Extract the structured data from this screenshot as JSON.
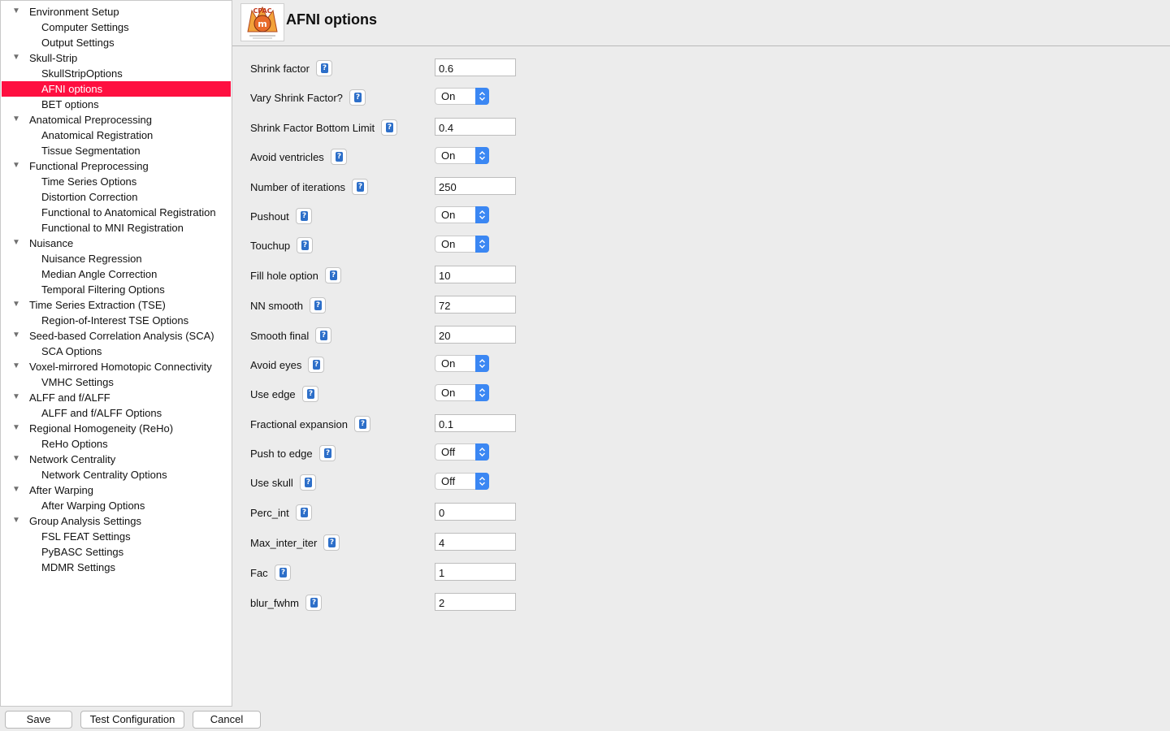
{
  "sidebar": {
    "items": [
      {
        "label": "Environment Setup",
        "level": 0
      },
      {
        "label": "Computer Settings",
        "level": 1
      },
      {
        "label": "Output Settings",
        "level": 1
      },
      {
        "label": "Skull-Strip",
        "level": 0
      },
      {
        "label": "SkullStripOptions",
        "level": 1
      },
      {
        "label": "AFNI options",
        "level": 1,
        "selected": true
      },
      {
        "label": "BET options",
        "level": 1
      },
      {
        "label": "Anatomical Preprocessing",
        "level": 0
      },
      {
        "label": "Anatomical Registration",
        "level": 1
      },
      {
        "label": "Tissue Segmentation",
        "level": 1
      },
      {
        "label": "Functional Preprocessing",
        "level": 0
      },
      {
        "label": "Time Series Options",
        "level": 1
      },
      {
        "label": "Distortion Correction",
        "level": 1
      },
      {
        "label": "Functional to Anatomical Registration",
        "level": 1
      },
      {
        "label": "Functional to MNI Registration",
        "level": 1
      },
      {
        "label": "Nuisance",
        "level": 0
      },
      {
        "label": "Nuisance Regression",
        "level": 1
      },
      {
        "label": "Median Angle Correction",
        "level": 1
      },
      {
        "label": "Temporal Filtering Options",
        "level": 1
      },
      {
        "label": "Time Series Extraction (TSE)",
        "level": 0
      },
      {
        "label": "Region-of-Interest TSE Options",
        "level": 1
      },
      {
        "label": "Seed-based Correlation Analysis (SCA)",
        "level": 0
      },
      {
        "label": "SCA Options",
        "level": 1
      },
      {
        "label": "Voxel-mirrored Homotopic Connectivity",
        "level": 0
      },
      {
        "label": "VMHC Settings",
        "level": 1
      },
      {
        "label": "ALFF and f/ALFF",
        "level": 0
      },
      {
        "label": "ALFF and f/ALFF Options",
        "level": 1
      },
      {
        "label": "Regional Homogeneity (ReHo)",
        "level": 0
      },
      {
        "label": "ReHo Options",
        "level": 1
      },
      {
        "label": "Network Centrality",
        "level": 0
      },
      {
        "label": "Network Centrality Options",
        "level": 1
      },
      {
        "label": "After Warping",
        "level": 0
      },
      {
        "label": "After Warping Options",
        "level": 1
      },
      {
        "label": "Group Analysis Settings",
        "level": 0
      },
      {
        "label": "FSL FEAT Settings",
        "level": 1
      },
      {
        "label": "PyBASC Settings",
        "level": 1
      },
      {
        "label": "MDMR Settings",
        "level": 1
      }
    ]
  },
  "header": {
    "title": "AFNI options",
    "logo_text": "CPAC"
  },
  "form": {
    "fields": [
      {
        "label": "Shrink factor",
        "type": "text",
        "value": "0.6"
      },
      {
        "label": "Vary Shrink Factor?",
        "type": "select",
        "value": "On"
      },
      {
        "label": "Shrink Factor Bottom Limit",
        "type": "text",
        "value": "0.4"
      },
      {
        "label": "Avoid ventricles",
        "type": "select",
        "value": "On"
      },
      {
        "label": "Number of iterations",
        "type": "text",
        "value": "250"
      },
      {
        "label": "Pushout",
        "type": "select",
        "value": "On"
      },
      {
        "label": "Touchup",
        "type": "select",
        "value": "On"
      },
      {
        "label": "Fill hole option",
        "type": "text",
        "value": "10"
      },
      {
        "label": "NN smooth",
        "type": "text",
        "value": "72"
      },
      {
        "label": "Smooth final",
        "type": "text",
        "value": "20"
      },
      {
        "label": "Avoid eyes",
        "type": "select",
        "value": "On"
      },
      {
        "label": "Use edge",
        "type": "select",
        "value": "On"
      },
      {
        "label": "Fractional expansion",
        "type": "text",
        "value": "0.1"
      },
      {
        "label": "Push to edge",
        "type": "select",
        "value": "Off"
      },
      {
        "label": "Use skull",
        "type": "select",
        "value": "Off"
      },
      {
        "label": "Perc_int",
        "type": "text",
        "value": "0"
      },
      {
        "label": "Max_inter_iter",
        "type": "text",
        "value": "4"
      },
      {
        "label": "Fac",
        "type": "text",
        "value": "1"
      },
      {
        "label": "blur_fwhm",
        "type": "text",
        "value": "2"
      }
    ]
  },
  "footer": {
    "save_label": "Save",
    "test_label": "Test Configuration",
    "cancel_label": "Cancel"
  },
  "colors": {
    "selection": "#fe0f40",
    "stepper": "#3b87f3",
    "help_icon": "#2d6fc9",
    "background": "#ececec"
  },
  "icons": {
    "tree_expander": "triangle-down-icon",
    "help": "help-icon",
    "select_stepper": "up-down-chevron-icon"
  }
}
